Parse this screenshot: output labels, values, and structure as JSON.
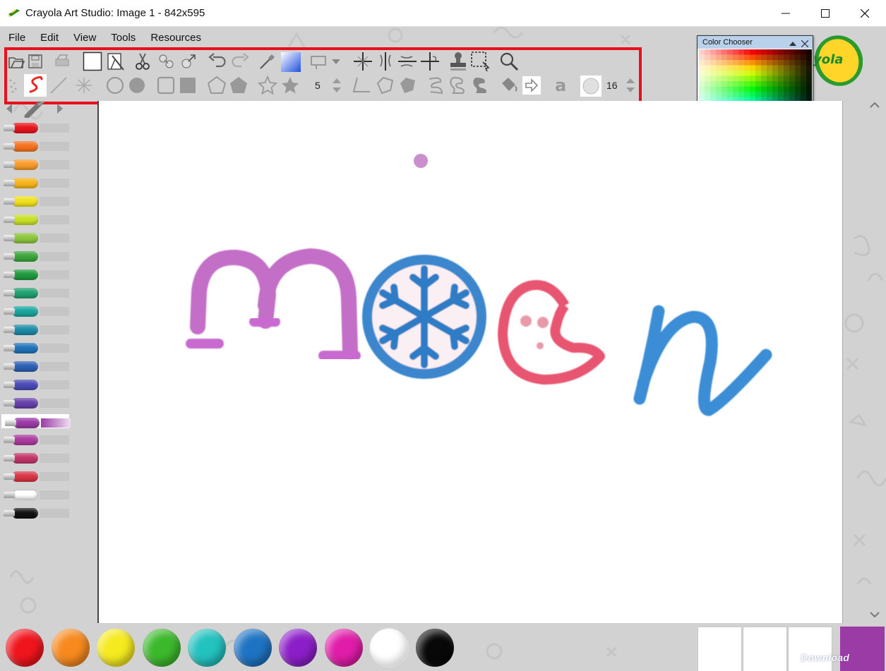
{
  "window": {
    "title": "Crayola Art Studio: Image 1 - 842x595"
  },
  "menu": [
    "File",
    "Edit",
    "View",
    "Tools",
    "Resources"
  ],
  "toolbar": {
    "top_row_icons": [
      "open-icon",
      "save-icon",
      "print-icon",
      "new-canvas-icon",
      "clear-icon",
      "cut-icon",
      "copy-icon",
      "paste-icon",
      "undo-icon",
      "redo-icon",
      "eyedropper-icon",
      "gradient-icon",
      "stamp-dropdown-icon",
      "mirror-both-icon",
      "mirror-vertical-icon",
      "mirror-horizontal-icon",
      "mirror-mixed-icon",
      "stamp-tool-icon",
      "select-icon",
      "zoom-icon"
    ],
    "brush_size": "5",
    "font_size": "16"
  },
  "color_chooser": {
    "title": "Color Chooser"
  },
  "logo": {
    "text": "yola"
  },
  "crayons": [
    {
      "color": "#e8141c"
    },
    {
      "color": "#f5731f"
    },
    {
      "color": "#f79a2a"
    },
    {
      "color": "#f7b51c"
    },
    {
      "color": "#f0e11b"
    },
    {
      "color": "#c9df26"
    },
    {
      "color": "#8dc43c"
    },
    {
      "color": "#3ca53a"
    },
    {
      "color": "#1f9a3f"
    },
    {
      "color": "#20a06f"
    },
    {
      "color": "#1aa59e"
    },
    {
      "color": "#1e8ba7"
    },
    {
      "color": "#1f73b8"
    },
    {
      "color": "#2c5fb5"
    },
    {
      "color": "#4b4ab7"
    },
    {
      "color": "#6740ab"
    },
    {
      "color": "#9b3ba6",
      "selected": true
    },
    {
      "color": "#ad3aa0"
    },
    {
      "color": "#c23568"
    },
    {
      "color": "#d93545"
    },
    {
      "color": "#ffffff"
    },
    {
      "color": "#111111"
    }
  ],
  "palette": [
    "#f0141c",
    "#f7891e",
    "#f5ea1f",
    "#3cb82c",
    "#22c2bf",
    "#1e73c2",
    "#8b1ec8",
    "#e01ca8",
    "#ffffff",
    "#080808"
  ],
  "current_color": "#9b3ba6",
  "watermark": "Download"
}
